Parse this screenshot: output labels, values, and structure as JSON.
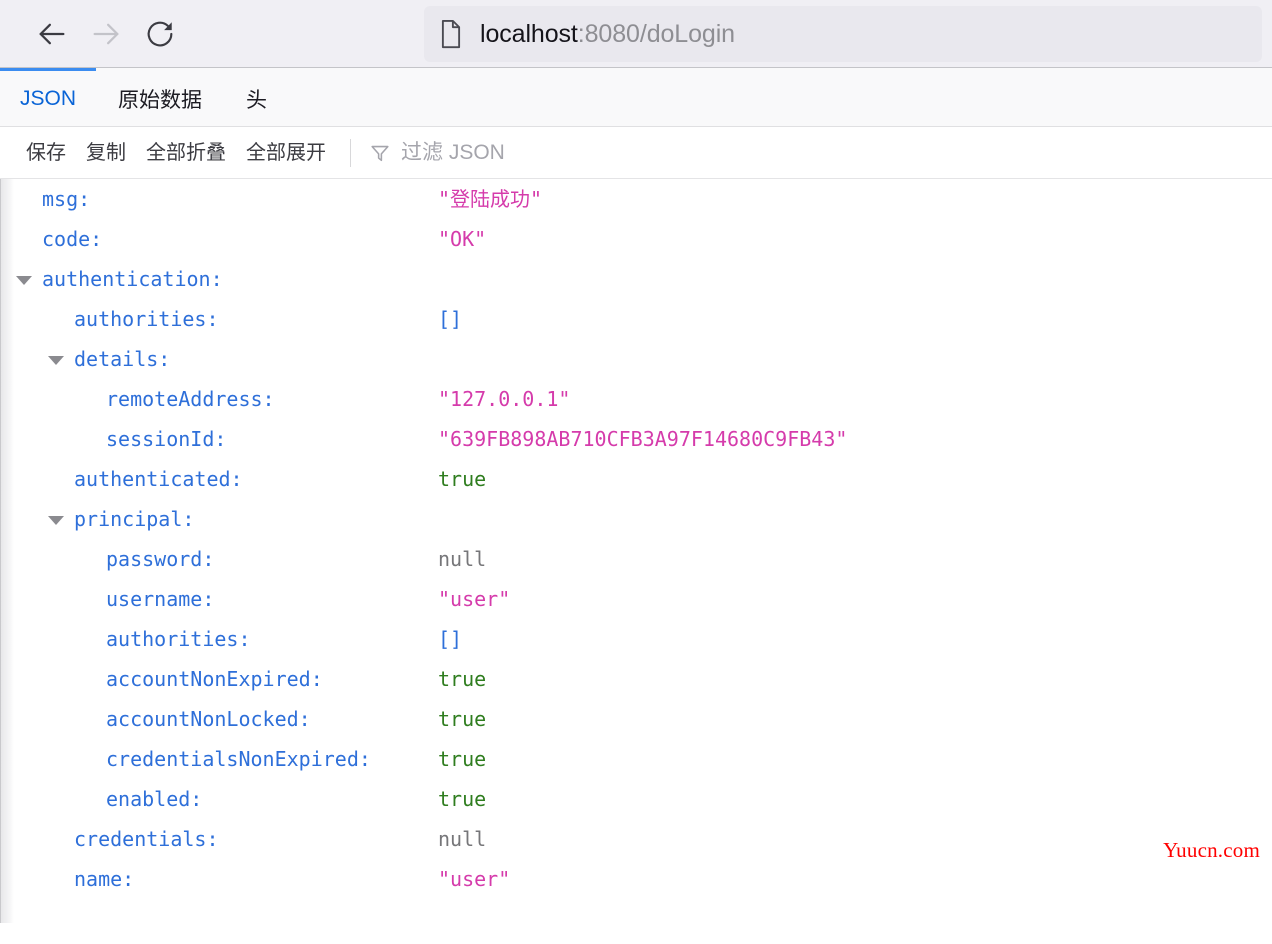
{
  "browser": {
    "back_label": "Back",
    "forward_label": "Forward",
    "reload_label": "Reload",
    "url_host": "localhost",
    "url_path": ":8080/doLogin"
  },
  "devtools": {
    "tabs": [
      {
        "label": "JSON",
        "active": true
      },
      {
        "label": "原始数据",
        "active": false
      },
      {
        "label": "头",
        "active": false
      }
    ],
    "toolbar": {
      "save_label": "保存",
      "copy_label": "复制",
      "collapse_all_label": "全部折叠",
      "expand_all_label": "全部展开",
      "filter_placeholder": "过滤 JSON",
      "filter_value": ""
    }
  },
  "json_rows": [
    {
      "key": "msg:",
      "indent": 1,
      "twisty": "",
      "value": "\"登陆成功\"",
      "type": "string"
    },
    {
      "key": "code:",
      "indent": 1,
      "twisty": "",
      "value": "\"OK\"",
      "type": "string"
    },
    {
      "key": "authentication:",
      "indent": 1,
      "twisty": "open",
      "value": "",
      "type": "none"
    },
    {
      "key": "authorities:",
      "indent": 2,
      "twisty": "",
      "value": "[]",
      "type": "array"
    },
    {
      "key": "details:",
      "indent": 2,
      "twisty": "open",
      "value": "",
      "type": "none"
    },
    {
      "key": "remoteAddress:",
      "indent": 3,
      "twisty": "",
      "value": "\"127.0.0.1\"",
      "type": "string"
    },
    {
      "key": "sessionId:",
      "indent": 3,
      "twisty": "",
      "value": "\"639FB898AB710CFB3A97F14680C9FB43\"",
      "type": "string"
    },
    {
      "key": "authenticated:",
      "indent": 2,
      "twisty": "",
      "value": "true",
      "type": "boolean"
    },
    {
      "key": "principal:",
      "indent": 2,
      "twisty": "open",
      "value": "",
      "type": "none"
    },
    {
      "key": "password:",
      "indent": 3,
      "twisty": "",
      "value": "null",
      "type": "null"
    },
    {
      "key": "username:",
      "indent": 3,
      "twisty": "",
      "value": "\"user\"",
      "type": "string"
    },
    {
      "key": "authorities:",
      "indent": 3,
      "twisty": "",
      "value": "[]",
      "type": "array"
    },
    {
      "key": "accountNonExpired:",
      "indent": 3,
      "twisty": "",
      "value": "true",
      "type": "boolean"
    },
    {
      "key": "accountNonLocked:",
      "indent": 3,
      "twisty": "",
      "value": "true",
      "type": "boolean"
    },
    {
      "key": "credentialsNonExpired:",
      "indent": 3,
      "twisty": "",
      "value": "true",
      "type": "boolean"
    },
    {
      "key": "enabled:",
      "indent": 3,
      "twisty": "",
      "value": "true",
      "type": "boolean"
    },
    {
      "key": "credentials:",
      "indent": 2,
      "twisty": "",
      "value": "null",
      "type": "null"
    },
    {
      "key": "name:",
      "indent": 2,
      "twisty": "",
      "value": "\"user\"",
      "type": "string"
    }
  ],
  "watermark": "Yuucn.com",
  "colors": {
    "key": "#2e6fd9",
    "string": "#d53bab",
    "boolean": "#2f7d1f",
    "null": "#767679",
    "tab_active": "#0a64d6",
    "tab_indicator": "#3b8cf0",
    "watermark": "#ff0000"
  }
}
